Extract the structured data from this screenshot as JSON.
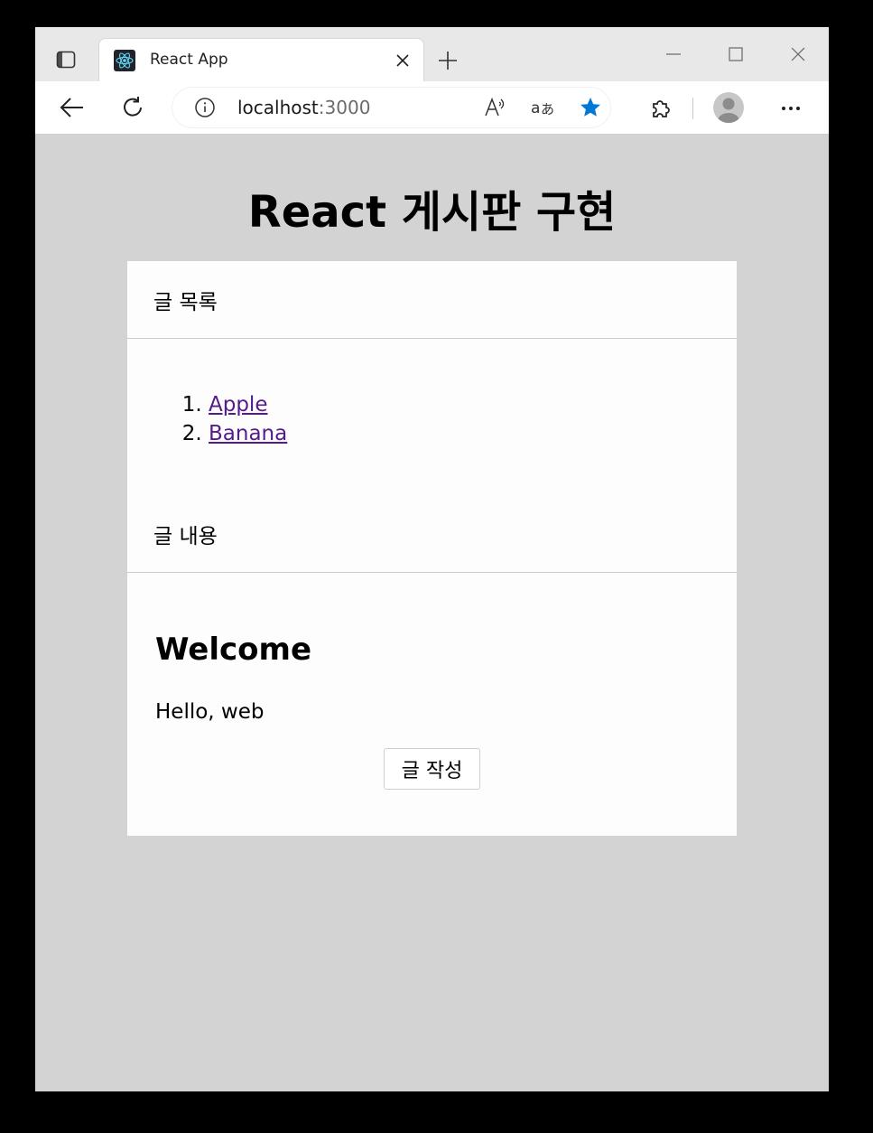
{
  "browser": {
    "tab": {
      "title": "React App"
    },
    "address": {
      "host": "localhost",
      "port": ":3000"
    },
    "icons": {
      "tab_actions": "tab-actions-icon",
      "favicon": "react-logo-icon",
      "close": "close-icon",
      "new_tab": "plus-icon",
      "minimize": "minimize-icon",
      "maximize": "maximize-icon",
      "window_close": "close-icon",
      "back": "back-arrow-icon",
      "reload": "reload-icon",
      "info": "info-icon",
      "read_aloud": "read-aloud-icon",
      "translate": "translate-icon",
      "favorite": "star-icon",
      "extensions": "puzzle-icon",
      "profile": "avatar-icon",
      "more": "more-icon"
    },
    "accent_color": "#0078d4"
  },
  "page": {
    "title": "React 게시판 구현",
    "list_section": {
      "heading": "글 목록",
      "items": [
        "Apple",
        "Banana"
      ],
      "numbers": [
        "1.",
        "2."
      ]
    },
    "content_section": {
      "heading": "글 내용",
      "title": "Welcome",
      "body": "Hello, web",
      "write_button": "글 작성"
    },
    "colors": {
      "background": "#d3d3d3",
      "card": "#fdfdfd",
      "link": "#551a8b"
    }
  }
}
